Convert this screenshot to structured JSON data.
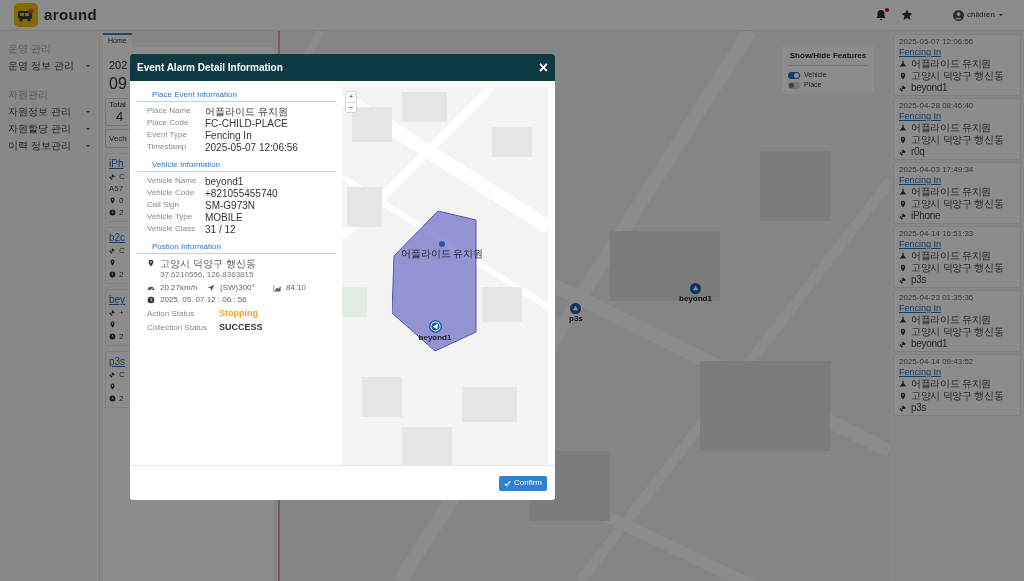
{
  "header": {
    "logo_text": "around",
    "user": "children",
    "has_notification": true
  },
  "sidebar": {
    "sections": [
      {
        "label": "운영 관리",
        "items": [
          {
            "label": "운영 정보 관리"
          }
        ]
      },
      {
        "label": "자원관리",
        "items": [
          {
            "label": "자원정보 관리"
          },
          {
            "label": "자원할당 관리"
          },
          {
            "label": "이력 정보관리"
          }
        ]
      }
    ]
  },
  "tabs": [
    {
      "label": "Home",
      "selected": true
    }
  ],
  "summary": {
    "date": "202",
    "time": "09",
    "total_label": "Total",
    "total_value": "4"
  },
  "search": {
    "placeholder": "Vech"
  },
  "vehicle_cards": [
    {
      "name": "iPh",
      "lines": [
        {
          "kind": "satellite",
          "text": "C"
        },
        {
          "kind": "plain",
          "text": "A57"
        },
        {
          "kind": "pin",
          "text": "0"
        },
        {
          "kind": "clock",
          "text": "2"
        }
      ]
    },
    {
      "name": "b2c",
      "lines": [
        {
          "kind": "satellite",
          "text": "C"
        },
        {
          "kind": "pin"
        },
        {
          "kind": "clock",
          "text": "2"
        }
      ]
    },
    {
      "name": "bey",
      "lines": [
        {
          "kind": "satellite",
          "text": "+"
        },
        {
          "kind": "pin"
        },
        {
          "kind": "clock",
          "text": "2"
        }
      ]
    },
    {
      "name": "p3s",
      "lines": [
        {
          "kind": "satellite",
          "text": "C"
        },
        {
          "kind": "pin"
        },
        {
          "kind": "clock",
          "text": "2"
        }
      ]
    }
  ],
  "map": {
    "markers": [
      {
        "label": "p3s"
      },
      {
        "label": "beyond1"
      }
    ],
    "features_panel": {
      "title": "Show/Hide Features",
      "toggles": [
        {
          "label": "Vehicle",
          "on": true
        },
        {
          "label": "Place",
          "on": false
        }
      ]
    }
  },
  "events": [
    {
      "timestamp": "2025-05-07 12:06:56",
      "event": "Fencing In",
      "place": "어플라이드 유치원",
      "address": "고양시 덕양구 행신동",
      "vehicle": "beyond1"
    },
    {
      "timestamp": "2025-04-28 08:46:40",
      "event": "Fencing In",
      "place": "어플라이드 유치원",
      "address": "고양시 덕양구 행신동",
      "vehicle": "r0q"
    },
    {
      "timestamp": "2025-04-03 17:49:34",
      "event": "Fencing In",
      "place": "어플라이드 유치원",
      "address": "고양시 덕양구 행신동",
      "vehicle": "iPhone"
    },
    {
      "timestamp": "2025-04-14 16:51:33",
      "event": "Fencing In",
      "place": "어플라이드 유치원",
      "address": "고양시 덕양구 행신동",
      "vehicle": "p3s"
    },
    {
      "timestamp": "2025-04-23 01:35:36",
      "event": "Fencing In",
      "place": "어플라이드 유치원",
      "address": "고양시 덕양구 행신동",
      "vehicle": "beyond1"
    },
    {
      "timestamp": "2025-04-14 09:43:52",
      "event": "Fencing In",
      "place": "어플라이드 유치원",
      "address": "고양시 덕양구 행신동",
      "vehicle": "p3s"
    }
  ],
  "modal": {
    "title": "Event Alarm Detail Information",
    "close": "×",
    "sections": [
      {
        "title": "Place Event Information",
        "fields": [
          {
            "label": "Place Name",
            "value": "어플라이드 유치원"
          },
          {
            "label": "Place Code",
            "value": "FC-CHILD-PLACE"
          },
          {
            "label": "Event Type",
            "value": "Fencing In"
          },
          {
            "label": "Timestamp",
            "value": "2025-05-07 12:06:56"
          }
        ]
      },
      {
        "title": "Vehicle Information",
        "fields": [
          {
            "label": "Vehicle Name",
            "value": "beyond1"
          },
          {
            "label": "Vehicle Code",
            "value": "+821055455740"
          },
          {
            "label": "Call Sign",
            "value": "SM-G973N"
          },
          {
            "label": "Vehicle Type",
            "value": "MOBILE"
          },
          {
            "label": "Vehicle Class",
            "value": "31 / 12"
          }
        ]
      }
    ],
    "position": {
      "title": "Postion Information",
      "address": "고양시 덕양구 행신동",
      "coords": "37.6210556, 126.8363815",
      "speed": "20.27km/h",
      "heading": "(SW)300°",
      "altitude": "84.10",
      "time": "2025. 05. 07 12 : 06 : 56",
      "statuses": [
        {
          "label": "Action Status",
          "value": "Stopping",
          "color": "#f5a623"
        },
        {
          "label": "Collection Status",
          "value": "SUCCESS",
          "color": "#333333"
        }
      ]
    },
    "map": {
      "place_label": "어플라이드 유치원",
      "vehicle_label": "beyond1",
      "zoom_in": "+",
      "zoom_out": "−"
    },
    "confirm": "Confirm"
  }
}
